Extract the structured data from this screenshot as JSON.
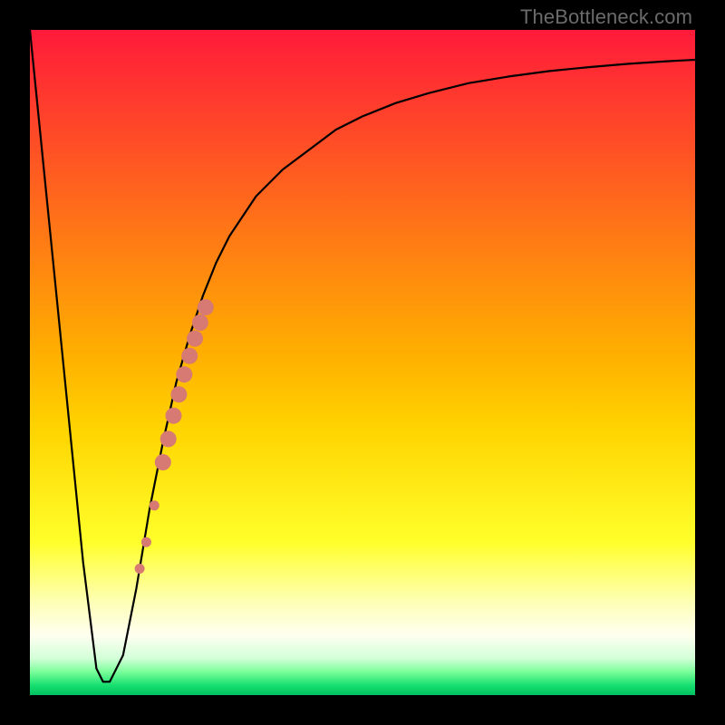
{
  "watermark": "TheBottleneck.com",
  "colors": {
    "frame": "#000000",
    "curve_stroke": "#000000",
    "marker_fill": "#d67a73",
    "watermark_text": "#6b6b6b",
    "gradient_stops": [
      {
        "pos": 0.0,
        "color": "#ff1a3a"
      },
      {
        "pos": 0.49,
        "color": "#ffb000"
      },
      {
        "pos": 0.6,
        "color": "#ffd400"
      },
      {
        "pos": 0.77,
        "color": "#ffff2a"
      },
      {
        "pos": 0.86,
        "color": "#fdffb5"
      },
      {
        "pos": 0.91,
        "color": "#fffff0"
      },
      {
        "pos": 0.945,
        "color": "#d2ffd8"
      },
      {
        "pos": 0.965,
        "color": "#7aff9a"
      },
      {
        "pos": 0.985,
        "color": "#18e070"
      },
      {
        "pos": 1.0,
        "color": "#00c060"
      }
    ]
  },
  "chart_data": {
    "type": "line",
    "title": "",
    "xlabel": "",
    "ylabel": "",
    "xlim": [
      0,
      100
    ],
    "ylim": [
      0,
      100
    ],
    "grid": false,
    "legend": false,
    "series": [
      {
        "name": "bottleneck-curve",
        "x": [
          0,
          4,
          8,
          10,
          11,
          12,
          14,
          16,
          18,
          20,
          22,
          24,
          26,
          28,
          30,
          34,
          38,
          42,
          46,
          50,
          55,
          60,
          66,
          72,
          78,
          84,
          90,
          96,
          100
        ],
        "values": [
          100,
          60,
          20,
          4,
          2,
          2,
          6,
          16,
          28,
          38,
          47,
          54,
          60,
          65,
          69,
          75,
          79,
          82,
          85,
          87,
          89,
          90.5,
          92,
          93,
          93.8,
          94.4,
          94.9,
          95.3,
          95.5
        ]
      }
    ],
    "markers": {
      "name": "highlight-segment",
      "points": [
        {
          "x": 16.5,
          "y": 19.0,
          "r": 5.5
        },
        {
          "x": 17.5,
          "y": 23.0,
          "r": 5.5
        },
        {
          "x": 18.7,
          "y": 28.5,
          "r": 5.5
        },
        {
          "x": 20.0,
          "y": 35.0,
          "r": 9.0
        },
        {
          "x": 20.8,
          "y": 38.5,
          "r": 9.0
        },
        {
          "x": 21.6,
          "y": 42.0,
          "r": 9.0
        },
        {
          "x": 22.4,
          "y": 45.2,
          "r": 9.0
        },
        {
          "x": 23.2,
          "y": 48.2,
          "r": 9.0
        },
        {
          "x": 24.0,
          "y": 51.0,
          "r": 9.0
        },
        {
          "x": 24.8,
          "y": 53.6,
          "r": 9.0
        },
        {
          "x": 25.6,
          "y": 56.0,
          "r": 9.0
        },
        {
          "x": 26.4,
          "y": 58.3,
          "r": 9.0
        }
      ]
    }
  }
}
